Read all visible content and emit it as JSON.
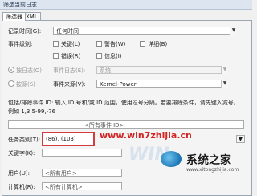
{
  "window": {
    "title": "筛选当前日志"
  },
  "tabs": [
    {
      "label": "筛选器"
    },
    {
      "label": "XML"
    }
  ],
  "filter": {
    "logged": {
      "label": "记录时间(G):",
      "value": "任何时间"
    },
    "level": {
      "label": "事件级别:",
      "options": [
        {
          "label": "关键(L)",
          "checked": false
        },
        {
          "label": "警告(W)",
          "checked": false
        },
        {
          "label": "详细(B)",
          "checked": false
        },
        {
          "label": "错误(R)",
          "checked": false
        },
        {
          "label": "信息(I)",
          "checked": false
        }
      ]
    },
    "by_log": {
      "radio_label": "按日志(O)",
      "field_label": "事件日志(E):",
      "value": "系统"
    },
    "by_source": {
      "radio_label": "按源(S)",
      "field_label": "事件来源(V):",
      "value": "Kernel-Power"
    },
    "help_text": "包括/排除事件 ID: 输入 ID 号和/或 ID 范围，使用逗号分隔。若要排除条件，请先键入减号。例如 1,3,5-99,-76",
    "event_ids": {
      "placeholder": "<所有事件 ID>"
    },
    "task_category": {
      "label": "任务类别(T):",
      "value": "(86), (103)"
    },
    "keywords": {
      "label": "关键字(K):"
    },
    "user": {
      "label": "用户(U):",
      "placeholder": "<所有用户>"
    },
    "computer": {
      "label": "计算机(R):",
      "placeholder": "<所有计算机>"
    }
  },
  "watermark": {
    "url": "www.win7zhijia.cn",
    "brand": "系统之家",
    "small_url": "www.xitongzhijia.com"
  },
  "colors": {
    "highlight": "#d23c3c",
    "watermark_url": "#d32424"
  }
}
